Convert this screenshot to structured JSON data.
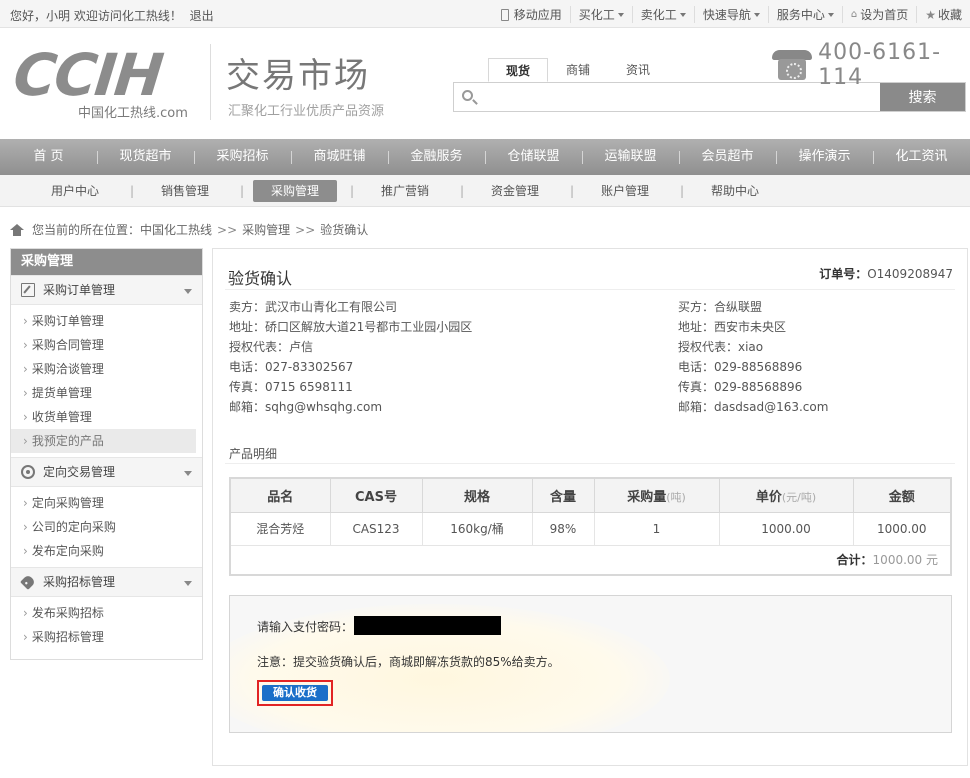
{
  "topbar": {
    "greeting": "您好，小明 欢迎访问化工热线！",
    "logout": "退出",
    "links": [
      "移动应用",
      "买化工",
      "卖化工",
      "快速导航",
      "服务中心",
      "设为首页",
      "收藏"
    ]
  },
  "header": {
    "logo_text": "CCIH",
    "logo_sub": "中国化工热线.com",
    "site_title": "交易市场",
    "site_subtitle": "汇聚化工行业优质产品资源",
    "search_tabs": [
      "现货",
      "商铺",
      "资讯"
    ],
    "active_tab": "现货",
    "search_placeholder": "",
    "search_button": "搜索",
    "hotline": "400-6161-114"
  },
  "main_nav": [
    "首 页",
    "现货超市",
    "采购招标",
    "商城旺铺",
    "金融服务",
    "仓储联盟",
    "运输联盟",
    "会员超市",
    "操作演示",
    "化工资讯"
  ],
  "sub_nav": [
    "用户中心",
    "销售管理",
    "采购管理",
    "推广营销",
    "资金管理",
    "账户管理",
    "帮助中心"
  ],
  "sub_nav_active": "采购管理",
  "breadcrumb": {
    "prefix": "您当前的所在位置：",
    "items": [
      "中国化工热线",
      "采购管理",
      "验货确认"
    ],
    "sep": ">>"
  },
  "sidebar": {
    "title": "采购管理",
    "groups": [
      {
        "label": "采购订单管理",
        "icon": "edit-icon",
        "items": [
          "采购订单管理",
          "采购合同管理",
          "采购洽谈管理",
          "提货单管理",
          "收货单管理",
          "我预定的产品"
        ]
      },
      {
        "label": "定向交易管理",
        "icon": "target-icon",
        "items": [
          "定向采购管理",
          "公司的定向采购",
          "发布定向采购"
        ]
      },
      {
        "label": "采购招标管理",
        "icon": "tag-icon",
        "items": [
          "发布采购招标",
          "采购招标管理"
        ]
      }
    ]
  },
  "content": {
    "title": "验货确认",
    "order_label": "订单号：",
    "order_no": "O1409208947",
    "seller": [
      "卖方：武汉市山青化工有限公司",
      "地址：硚口区解放大道21号都市工业园小园区",
      "授权代表：卢信",
      "电话：027-83302567",
      "传真：0715 6598111",
      "邮箱：sqhg@whsqhg.com"
    ],
    "buyer": [
      "买方：合纵联盟",
      "地址：西安市未央区",
      "授权代表：xiao",
      "电话：029-88568896",
      "传真：029-88568896",
      "邮箱：dasdsad@163.com"
    ],
    "detail_label": "产品明细",
    "table": {
      "headers": [
        "品名",
        "CAS号",
        "规格",
        "含量",
        "采购量",
        "单价",
        "金额"
      ],
      "header_units": [
        "",
        "",
        "",
        "",
        "(吨)",
        "(元/吨)",
        ""
      ],
      "rows": [
        [
          "混合芳烃",
          "CAS123",
          "160kg/桶",
          "98%",
          "1",
          "1000.00",
          "1000.00"
        ]
      ],
      "total_label": "合计：",
      "total_value": "1000.00 元"
    },
    "pay": {
      "label": "请输入支付密码：",
      "note": "注意：提交验货确认后，商城即解冻货款的85%给卖方。",
      "button": "确认收货"
    }
  }
}
